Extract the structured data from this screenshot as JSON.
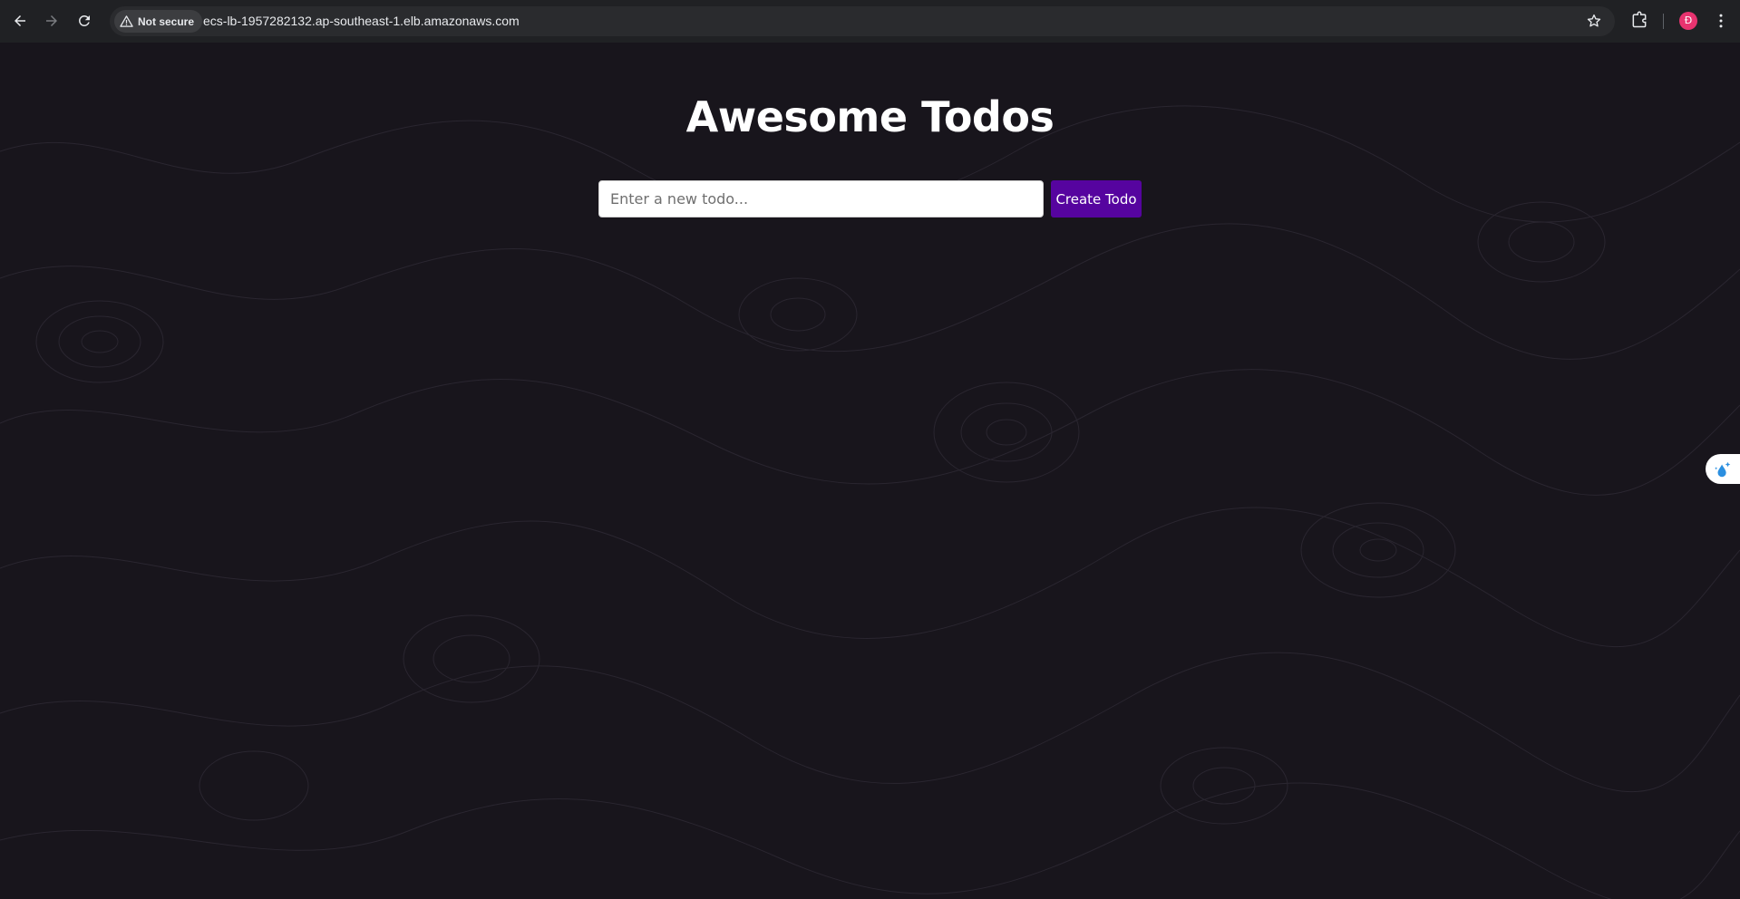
{
  "browser": {
    "security_label": "Not secure",
    "url": "ecs-lb-1957282132.ap-southeast-1.elb.amazonaws.com",
    "avatar_letter": "Đ",
    "icons": {
      "back": "arrow-left-icon",
      "forward": "arrow-right-icon",
      "reload": "reload-icon",
      "security": "warning-triangle-icon",
      "bookmark": "star-icon",
      "extensions": "puzzle-icon",
      "menu": "kebab-menu-icon"
    },
    "colors": {
      "chrome": "#202124",
      "omnibox": "#2a2b2e",
      "avatar": "#e8336f"
    }
  },
  "app": {
    "title": "Awesome Todos",
    "input_placeholder": "Enter a new todo...",
    "input_value": "",
    "create_button_label": "Create Todo",
    "colors": {
      "background": "#18151c",
      "button": "#56049f",
      "title": "#ffffff"
    }
  },
  "side_widget": {
    "icon": "water-drop-sparkle-icon"
  }
}
